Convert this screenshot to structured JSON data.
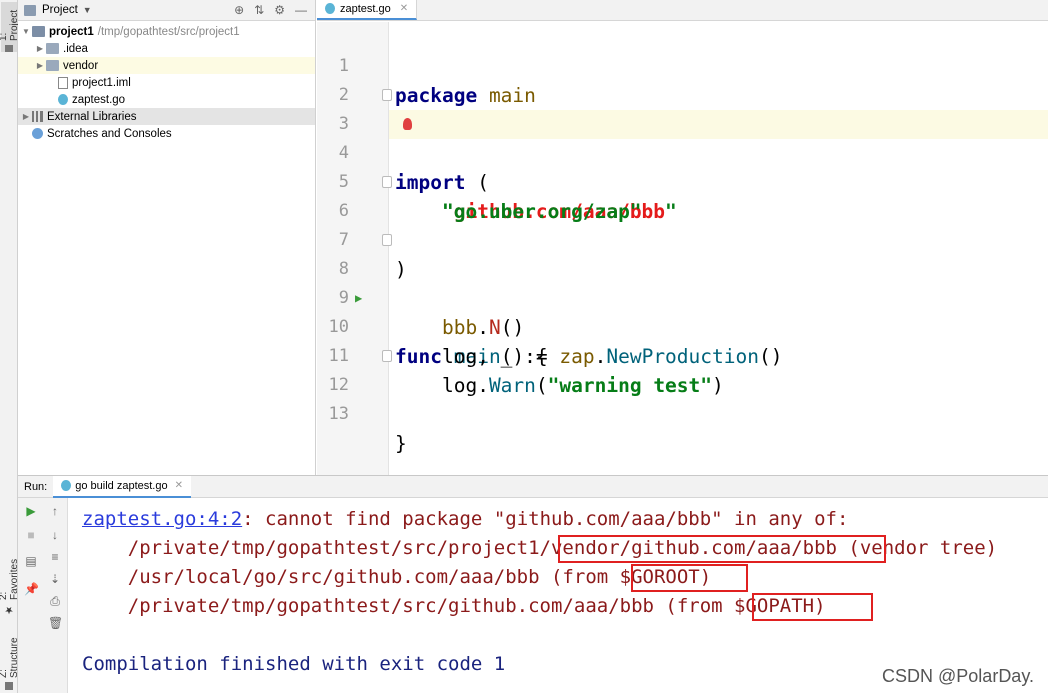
{
  "toolstrip": {
    "project_tab": "1: Project",
    "favorites_tab": "2: Favorites",
    "structure_tab": "Z: Structure"
  },
  "project_panel": {
    "title": "Project",
    "tree": [
      {
        "name": "project1",
        "path": "/tmp/gopathtest/src/project1"
      },
      {
        "name": ".idea"
      },
      {
        "name": "vendor"
      },
      {
        "name": "project1.iml"
      },
      {
        "name": "zaptest.go"
      },
      {
        "name": "External Libraries"
      },
      {
        "name": "Scratches and Consoles"
      }
    ]
  },
  "editor": {
    "tab_label": "zaptest.go",
    "line_numbers": [
      "1",
      "2",
      "3",
      "4",
      "5",
      "6",
      "7",
      "8",
      "9",
      "10",
      "11",
      "12",
      "13"
    ],
    "code": {
      "l1_kw": "package",
      "l1_name": "main",
      "l3_kw": "import",
      "l3_paren": "(",
      "l4_q1": "\"",
      "l4_str": "github.com/aaa/bbb",
      "l4_q2": "\"",
      "l5_str": "\"go.uber.org/zap\"",
      "l6": ")",
      "l8_kw": "func",
      "l8_fn": "main",
      "l8_rest": "() {",
      "l9_pkg": "bbb",
      "l9_dot": ".",
      "l9_call": "N",
      "l9_rest": "()",
      "l10_a": "log, _ := ",
      "l10_pkg": "zap",
      "l10_dot": ".",
      "l10_fn": "NewProduction",
      "l10_rest": "()",
      "l11_a": "log.",
      "l11_fn": "Warn",
      "l11_p1": "(",
      "l11_str": "\"warning test\"",
      "l11_p2": ")",
      "l12": "}"
    }
  },
  "run_panel": {
    "run_label": "Run:",
    "tab_label": "go build zaptest.go",
    "console": {
      "link": "zaptest.go:4:2",
      "msg1": ": cannot find package \"github.com/aaa/bbb\" in any of:",
      "l2": "    /private/tmp/gopathtest/src/project1/vendor/github.com/aaa/bbb (vendor tree)",
      "l3": "    /usr/local/go/src/github.com/aaa/bbb (from $GOROOT)",
      "l4": "    /private/tmp/gopathtest/src/github.com/aaa/bbb (from $GOPATH)",
      "l6": "Compilation finished with exit code 1"
    }
  },
  "watermark": "CSDN @PolarDay."
}
